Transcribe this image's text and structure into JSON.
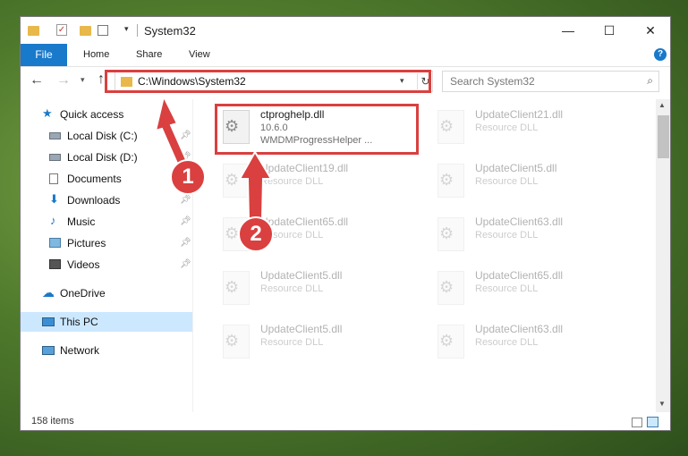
{
  "window": {
    "title": "System32",
    "controls": {
      "minimize": "—",
      "maximize": "☐",
      "close": "✕"
    }
  },
  "ribbon": {
    "tabs": [
      "File",
      "Home",
      "Share",
      "View"
    ],
    "help": "?"
  },
  "address": {
    "path": "C:\\Windows\\System32"
  },
  "search": {
    "placeholder": "Search System32"
  },
  "sidebar": {
    "items": [
      {
        "label": "Quick access",
        "pinned": false
      },
      {
        "label": "Local Disk (C:)",
        "pinned": true
      },
      {
        "label": "Local Disk (D:)",
        "pinned": true
      },
      {
        "label": "Documents",
        "pinned": true
      },
      {
        "label": "Downloads",
        "pinned": true
      },
      {
        "label": "Music",
        "pinned": true
      },
      {
        "label": "Pictures",
        "pinned": true
      },
      {
        "label": "Videos",
        "pinned": true
      },
      {
        "label": "OneDrive",
        "pinned": false
      },
      {
        "label": "This PC",
        "pinned": false
      },
      {
        "label": "Network",
        "pinned": false
      }
    ]
  },
  "files": [
    {
      "name": "ctproghelp.dll",
      "version": "10.6.0",
      "desc": "WMDMProgressHelper ..."
    },
    {
      "name": "UpdateClient21.dll",
      "desc": "Resource DLL"
    },
    {
      "name": "UpdateClient19.dll",
      "desc": "Resource DLL"
    },
    {
      "name": "UpdateClient5.dll",
      "desc": "Resource DLL"
    },
    {
      "name": "UpdateClient65.dll",
      "desc": "Resource DLL"
    },
    {
      "name": "UpdateClient63.dll",
      "desc": "Resource DLL"
    },
    {
      "name": "UpdateClient5.dll",
      "desc": "Resource DLL"
    },
    {
      "name": "UpdateClient65.dll",
      "desc": "Resource DLL"
    },
    {
      "name": "UpdateClient5.dll",
      "desc": "Resource DLL"
    },
    {
      "name": "UpdateClient63.dll",
      "desc": "Resource DLL"
    }
  ],
  "status": {
    "item_count": "158 items"
  },
  "annotations": {
    "badge1": "1",
    "badge2": "2",
    "color": "#d9403f"
  }
}
